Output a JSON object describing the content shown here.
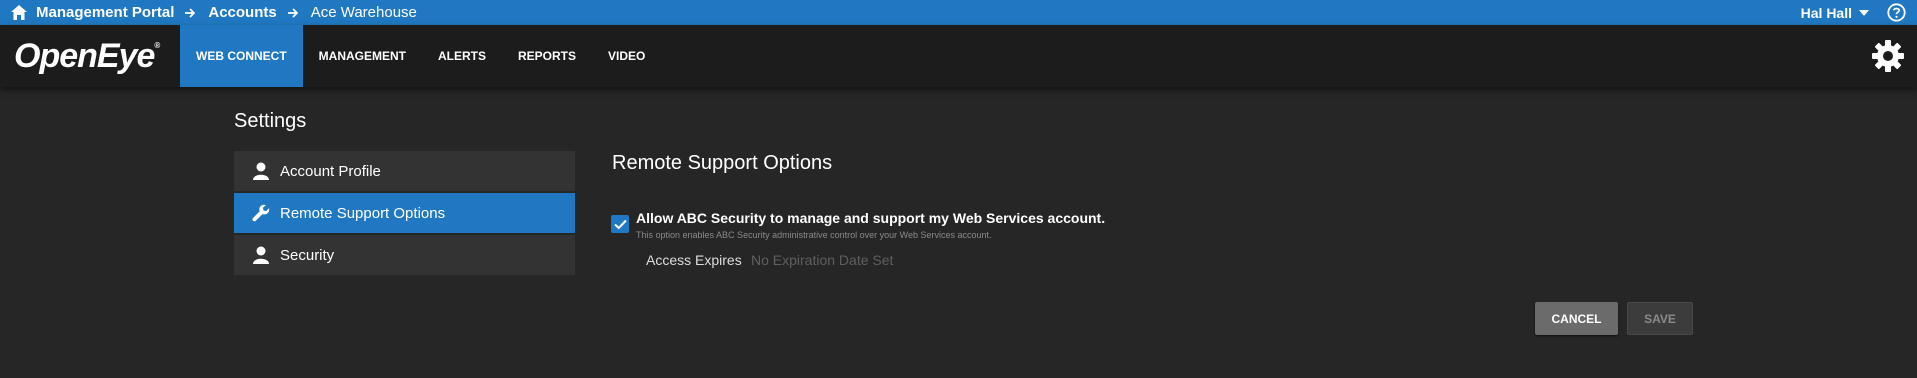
{
  "breadcrumb": {
    "items": [
      "Management Portal",
      "Accounts",
      "Ace Warehouse"
    ]
  },
  "user": {
    "name": "Hal Hall"
  },
  "nav": {
    "logo": "OpenEye",
    "items": [
      "WEB CONNECT",
      "MANAGEMENT",
      "ALERTS",
      "REPORTS",
      "VIDEO"
    ],
    "active": "WEB CONNECT"
  },
  "settings": {
    "title": "Settings",
    "menu": [
      {
        "label": "Account Profile",
        "icon": "user-icon"
      },
      {
        "label": "Remote Support Options",
        "icon": "wrench-icon"
      },
      {
        "label": "Security",
        "icon": "user-icon"
      }
    ],
    "active": "Remote Support Options"
  },
  "panel": {
    "title": "Remote Support Options",
    "allow_checked": true,
    "allow_label": "Allow ABC Security to manage and support my Web Services account.",
    "allow_description": "This option enables ABC Security administrative control over your Web Services account.",
    "expires_label": "Access Expires",
    "expires_value": "No Expiration Date Set"
  },
  "buttons": {
    "cancel": "CANCEL",
    "save": "SAVE"
  },
  "colors": {
    "accent": "#1f78c1",
    "nav_bg": "#1c1c1c",
    "page_bg": "#262626"
  }
}
